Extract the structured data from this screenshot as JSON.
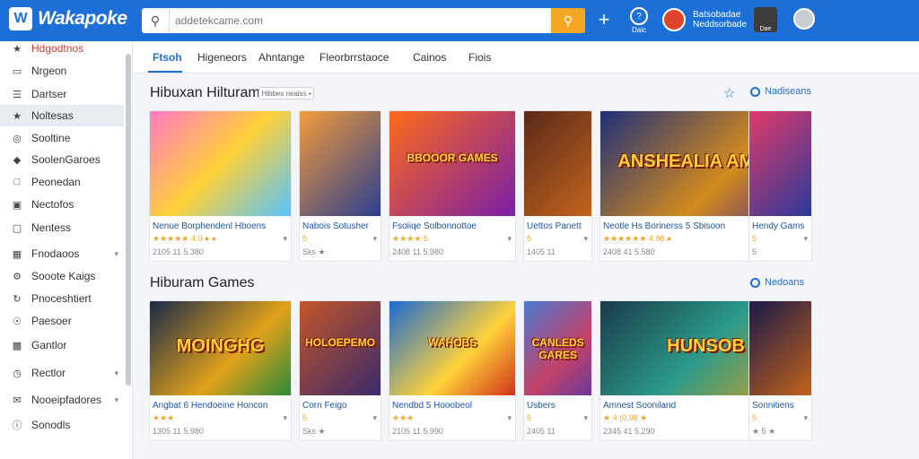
{
  "header": {
    "logo": "Wakapoke",
    "search_placeholder": "addetekcame.com",
    "help_label": "Dalc",
    "user_name_line1": "Batsobadae",
    "user_name_line2": "Neddsorbade",
    "game_label": "Dae"
  },
  "sidebar": {
    "items": [
      {
        "label": "Hdgodtnos",
        "icon": "bookmark-icon"
      },
      {
        "label": "Nrgeon",
        "icon": "folder-icon"
      },
      {
        "label": "Dartser",
        "icon": "list-icon"
      },
      {
        "label": "Noltesas",
        "icon": "bookmark-icon"
      },
      {
        "label": "Sooltine",
        "icon": "compass-icon"
      },
      {
        "label": "SoolenGaroes",
        "icon": "tag-icon"
      },
      {
        "label": "Peonedan",
        "icon": "file-icon"
      },
      {
        "label": "Nectofos",
        "icon": "image-icon"
      },
      {
        "label": "Nentess",
        "icon": "doc-icon"
      },
      {
        "label": "Fnodaoos",
        "icon": "grid-icon"
      },
      {
        "label": "Sooote Kaigs",
        "icon": "settings-icon"
      },
      {
        "label": "Pnoceshtiert",
        "icon": "refresh-icon"
      },
      {
        "label": "Paesoer",
        "icon": "user-icon"
      },
      {
        "label": "Gantlor",
        "icon": "table-icon"
      },
      {
        "label": "Rectlor",
        "icon": "clock-icon"
      },
      {
        "label": "Nooeipfadores",
        "icon": "mail-icon"
      },
      {
        "label": "Sonodls",
        "icon": "info-icon"
      }
    ]
  },
  "tabs": [
    "Ftsoh",
    "Higeneors",
    "Ahntange",
    "Fleorbrrstaoce",
    "Cainos",
    "Fiois"
  ],
  "section1": {
    "title": "Hibuxan Hilturam",
    "chip": "Hibbes nealss ▪",
    "link": "Nadiseans",
    "cards": [
      {
        "title": "Nenue Borphendenl Hboens",
        "rating": "★★★★★ 4.0 ● ●",
        "meta": "2105 11 5.380",
        "art": ""
      },
      {
        "title": "Nabois Sotusher",
        "rating": "5",
        "meta": "Sks ★",
        "art": ""
      },
      {
        "title": "Fsoiiqe Solbonnottoe",
        "rating": "★★★★ 5",
        "meta": "2408 11 5.980",
        "art": "BBOOOR GAMES"
      },
      {
        "title": "Uettos Panett",
        "rating": "5",
        "meta": "1405 11",
        "art": ""
      },
      {
        "title": "Neotle Hs Borinerss 5 Sbisoon",
        "rating": "★★★★★★ 4.98 ●",
        "meta": "2408 41 5.580",
        "art": "ANSHEALIA AMMUE"
      },
      {
        "title": "Hendy Gams",
        "rating": "5",
        "meta": "5",
        "art": ""
      }
    ]
  },
  "section2": {
    "title": "Hiburam Games",
    "link": "Nedoans",
    "cards": [
      {
        "title": "Angbat 6 Hendoeine Honcon",
        "rating": "★★★",
        "meta": "1305 11 5.980",
        "art": "MOINGHG"
      },
      {
        "title": "Corn Feigo",
        "rating": "5",
        "meta": "Sks ★",
        "art": "HOLOEPEMO"
      },
      {
        "title": "Nendbd 5 Hooobeol",
        "rating": "★★★",
        "meta": "2105 11 5.990",
        "art": "WAHOBS"
      },
      {
        "title": "Usbers",
        "rating": "5",
        "meta": "2405 11",
        "art": "CANLEDS GARES"
      },
      {
        "title": "Amnest Sooniland",
        "rating": "★ 4 (0.98 ★",
        "meta": "2345 41 5.290",
        "art": "HUNSOB"
      },
      {
        "title": "Sonnitiens",
        "rating": "5",
        "meta": "★ 5 ★",
        "art": ""
      }
    ]
  },
  "colors": {
    "brand": "#1c6fd6",
    "accent": "#f5a623",
    "active_side": "#d43a2f"
  }
}
